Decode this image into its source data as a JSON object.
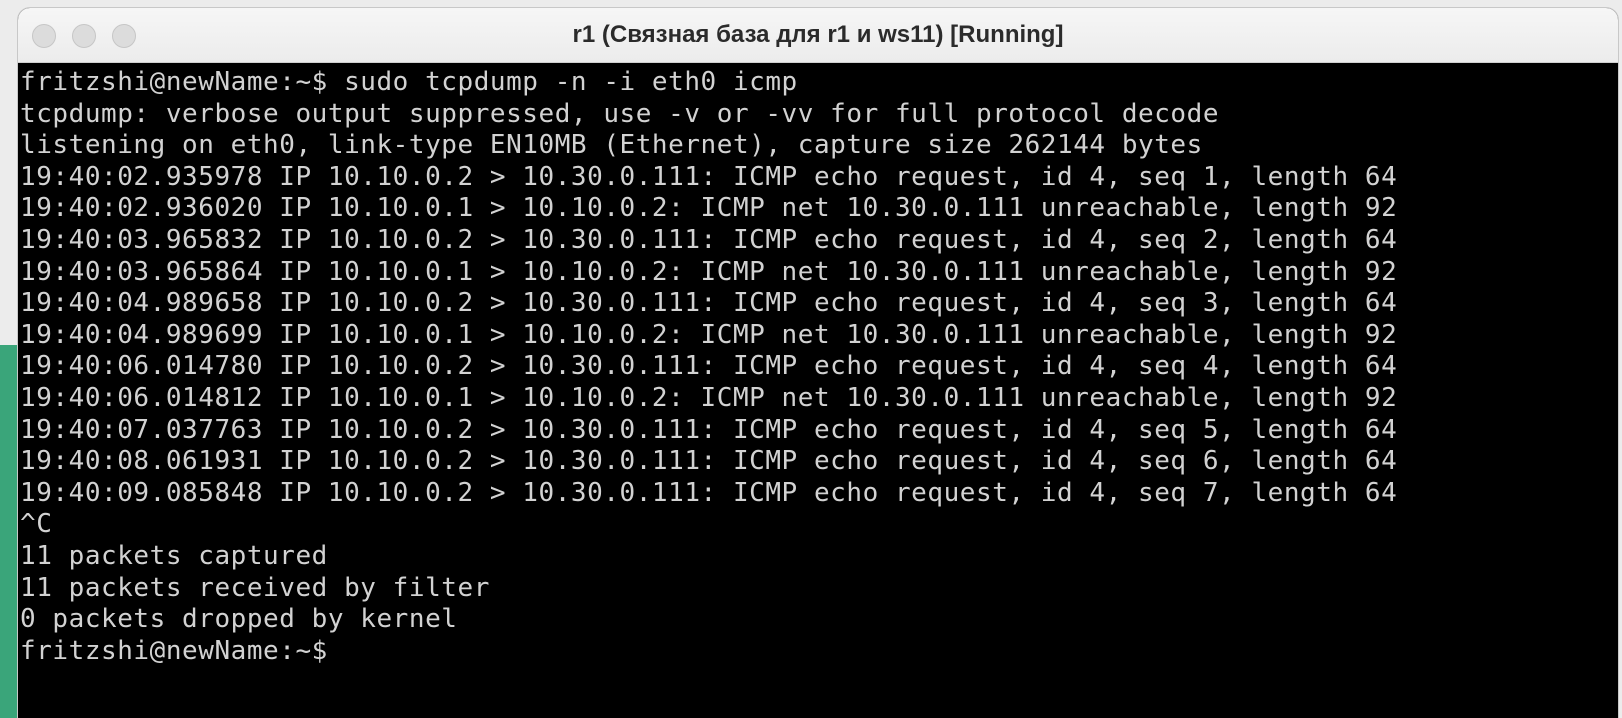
{
  "window": {
    "title": "r1 (Связная база для r1 и ws11) [Running]"
  },
  "colors": {
    "terminal_background": "#000000",
    "terminal_text": "#d2d2d2",
    "titlebar": "#ececec"
  },
  "terminal": {
    "lines": [
      "fritzshi@newName:~$ sudo tcpdump -n -i eth0 icmp",
      "tcpdump: verbose output suppressed, use -v or -vv for full protocol decode",
      "listening on eth0, link-type EN10MB (Ethernet), capture size 262144 bytes",
      "19:40:02.935978 IP 10.10.0.2 > 10.30.0.111: ICMP echo request, id 4, seq 1, length 64",
      "19:40:02.936020 IP 10.10.0.1 > 10.10.0.2: ICMP net 10.30.0.111 unreachable, length 92",
      "19:40:03.965832 IP 10.10.0.2 > 10.30.0.111: ICMP echo request, id 4, seq 2, length 64",
      "19:40:03.965864 IP 10.10.0.1 > 10.10.0.2: ICMP net 10.30.0.111 unreachable, length 92",
      "19:40:04.989658 IP 10.10.0.2 > 10.30.0.111: ICMP echo request, id 4, seq 3, length 64",
      "19:40:04.989699 IP 10.10.0.1 > 10.10.0.2: ICMP net 10.30.0.111 unreachable, length 92",
      "19:40:06.014780 IP 10.10.0.2 > 10.30.0.111: ICMP echo request, id 4, seq 4, length 64",
      "19:40:06.014812 IP 10.10.0.1 > 10.10.0.2: ICMP net 10.30.0.111 unreachable, length 92",
      "19:40:07.037763 IP 10.10.0.2 > 10.30.0.111: ICMP echo request, id 4, seq 5, length 64",
      "19:40:08.061931 IP 10.10.0.2 > 10.30.0.111: ICMP echo request, id 4, seq 6, length 64",
      "19:40:09.085848 IP 10.10.0.2 > 10.30.0.111: ICMP echo request, id 4, seq 7, length 64",
      "^C",
      "11 packets captured",
      "11 packets received by filter",
      "0 packets dropped by kernel",
      "fritzshi@newName:~$"
    ]
  }
}
